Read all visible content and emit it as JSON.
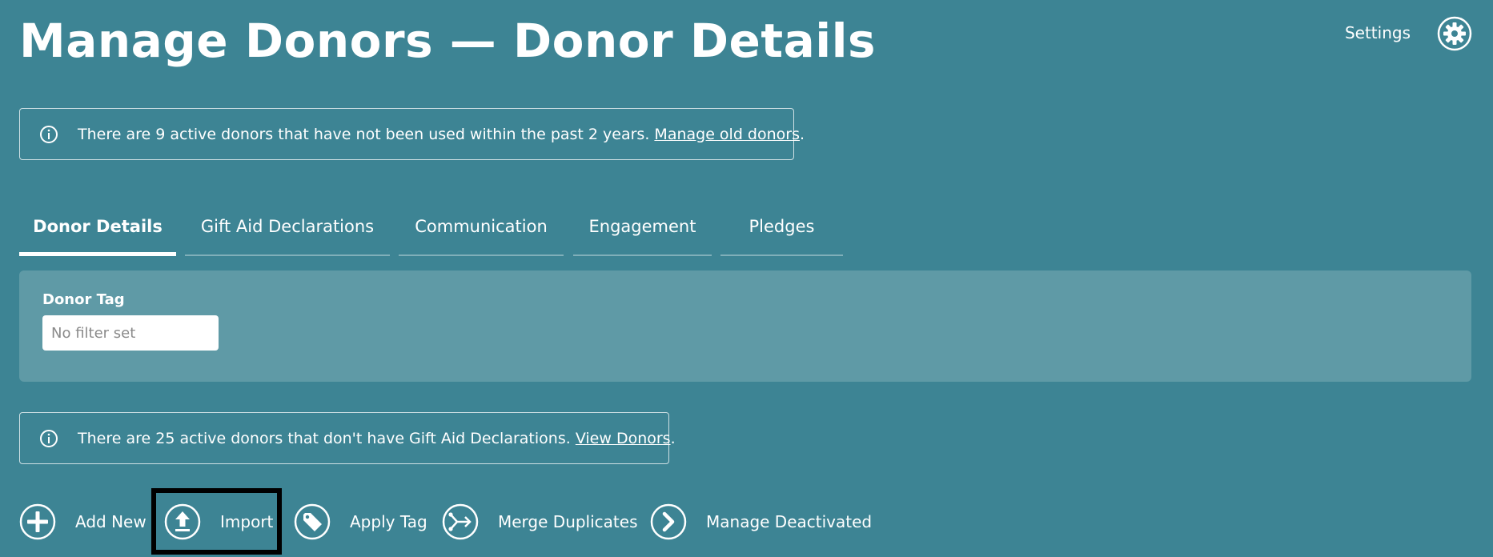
{
  "header": {
    "title": "Manage Donors — Donor Details",
    "settings_label": "Settings",
    "settings_icon": "gear-icon"
  },
  "banners": {
    "old_donors": {
      "icon": "info-icon",
      "text": "There are 9 active donors that have not been used within the past 2 years.",
      "link": "Manage old donors",
      "suffix": "."
    },
    "gift_aid": {
      "icon": "info-icon",
      "text": "There are 25 active donors that don't have Gift Aid Declarations.",
      "link": "View Donors",
      "suffix": "."
    }
  },
  "tabs": [
    {
      "label": "Donor Details",
      "active": true
    },
    {
      "label": "Gift Aid Declarations",
      "active": false
    },
    {
      "label": "Communication",
      "active": false
    },
    {
      "label": "Engagement",
      "active": false
    },
    {
      "label": "Pledges",
      "active": false
    }
  ],
  "filters": {
    "donor_tag": {
      "label": "Donor Tag",
      "placeholder": "No filter set",
      "value": ""
    }
  },
  "actions": [
    {
      "label": "Add New",
      "icon": "plus-circle-icon"
    },
    {
      "label": "Import",
      "icon": "upload-icon"
    },
    {
      "label": "Apply Tag",
      "icon": "tag-icon"
    },
    {
      "label": "Merge Duplicates",
      "icon": "merge-icon"
    },
    {
      "label": "Manage Deactivated",
      "icon": "chevron-right-icon"
    }
  ],
  "colors": {
    "background": "#3d8494",
    "panel": "#5f9aa6",
    "text": "#ffffff",
    "highlight_border": "#000000"
  }
}
